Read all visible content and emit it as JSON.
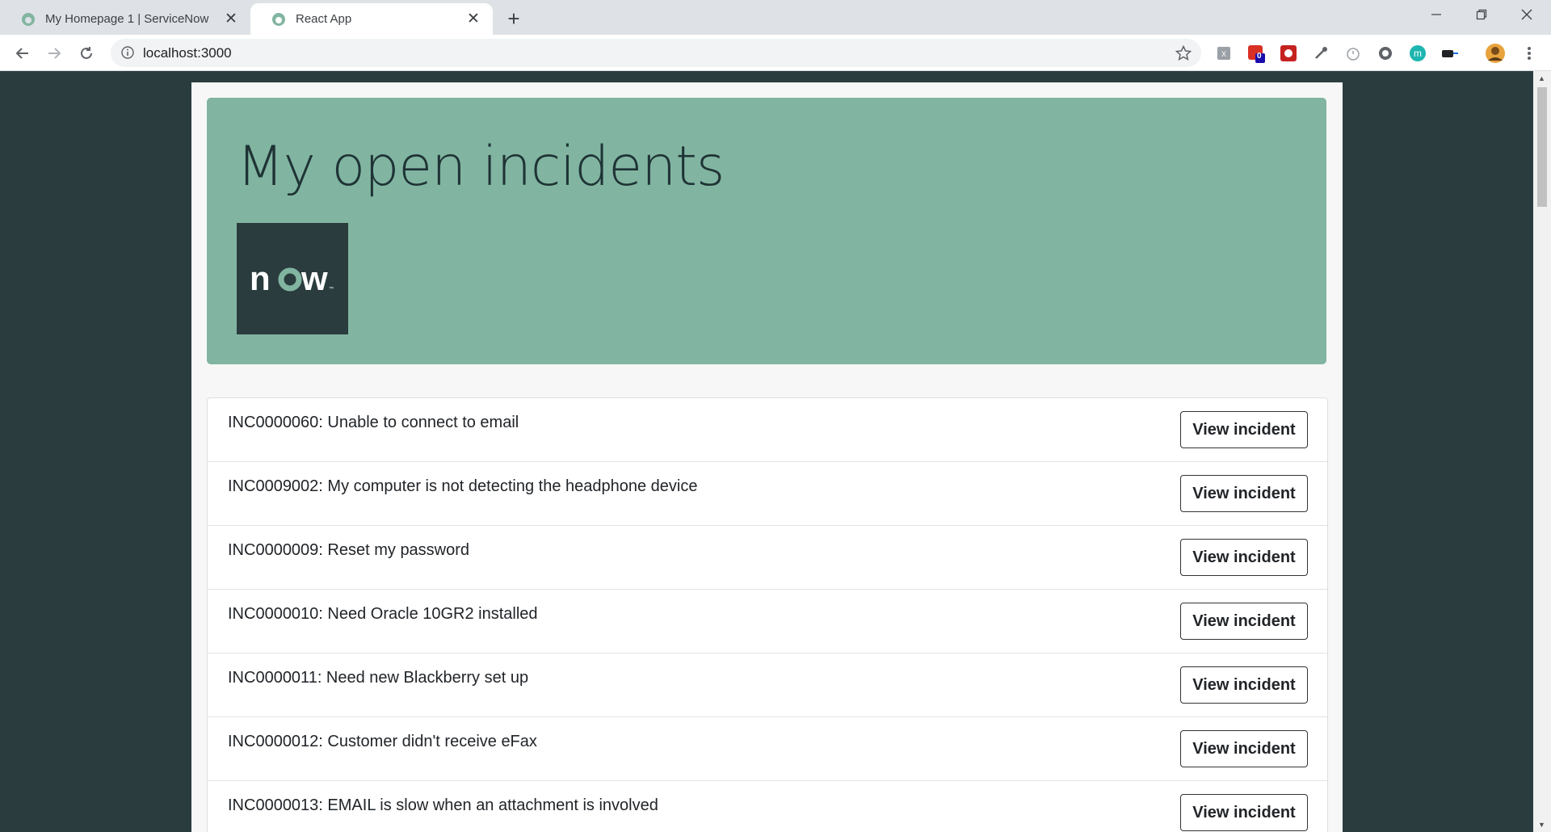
{
  "browser": {
    "tabs": [
      {
        "title": "My Homepage 1 | ServiceNow",
        "active": false
      },
      {
        "title": "React App",
        "active": true
      }
    ],
    "new_tab_label": "+",
    "url": "localhost:3000",
    "extension_badge": "0"
  },
  "page": {
    "heading": "My open incidents",
    "logo_text": "now",
    "incidents": [
      {
        "label": "INC0000060: Unable to connect to email",
        "button": "View incident"
      },
      {
        "label": "INC0009002: My computer is not detecting the headphone device",
        "button": "View incident"
      },
      {
        "label": "INC0000009: Reset my password",
        "button": "View incident"
      },
      {
        "label": "INC0000010: Need Oracle 10GR2 installed",
        "button": "View incident"
      },
      {
        "label": "INC0000011: Need new Blackberry set up",
        "button": "View incident"
      },
      {
        "label": "INC0000012: Customer didn't receive eFax",
        "button": "View incident"
      },
      {
        "label": "INC0000013: EMAIL is slow when an attachment is involved",
        "button": "View incident"
      }
    ]
  },
  "colors": {
    "page_background": "#2a3c3e",
    "hero_background": "#81b5a1",
    "container_background": "#f7f7f7"
  }
}
